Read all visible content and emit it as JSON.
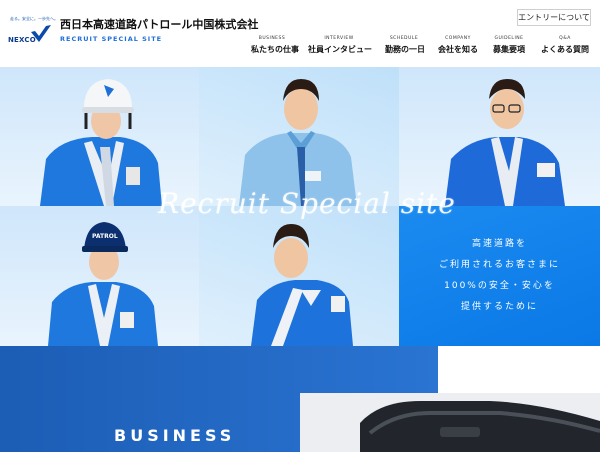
{
  "header": {
    "logo_tagline": "走る。安全に。一歩先へ。",
    "logo_wordmark": "NEXCO",
    "company_name": "西日本高速道路パトロール中国株式会社",
    "site_subtitle": "RECRUIT SPECIAL SITE",
    "entry_label": "エントリーについて"
  },
  "nav": [
    {
      "en": "BUSINESS",
      "ja": "私たちの仕事"
    },
    {
      "en": "INTERVIEW",
      "ja": "社員インタビュー"
    },
    {
      "en": "SCHEDULE",
      "ja": "勤務の一日"
    },
    {
      "en": "COMPANY",
      "ja": "会社を知る"
    },
    {
      "en": "GUIDELINE",
      "ja": "募集要項"
    },
    {
      "en": "Q&A",
      "ja": "よくある質問"
    }
  ],
  "hero": {
    "script_title": "Recruit Special site",
    "message_lines": [
      "高速道路を",
      "ご利用されるお客さまに",
      "100%の安全・安心を",
      "提供するために"
    ],
    "cap_text": "PATROL"
  },
  "business": {
    "title": "BUSINESS"
  },
  "colors": {
    "brand_blue": "#1f6fd8",
    "message_blue": "#0f82ec",
    "business_blue": "#1c5db5"
  }
}
